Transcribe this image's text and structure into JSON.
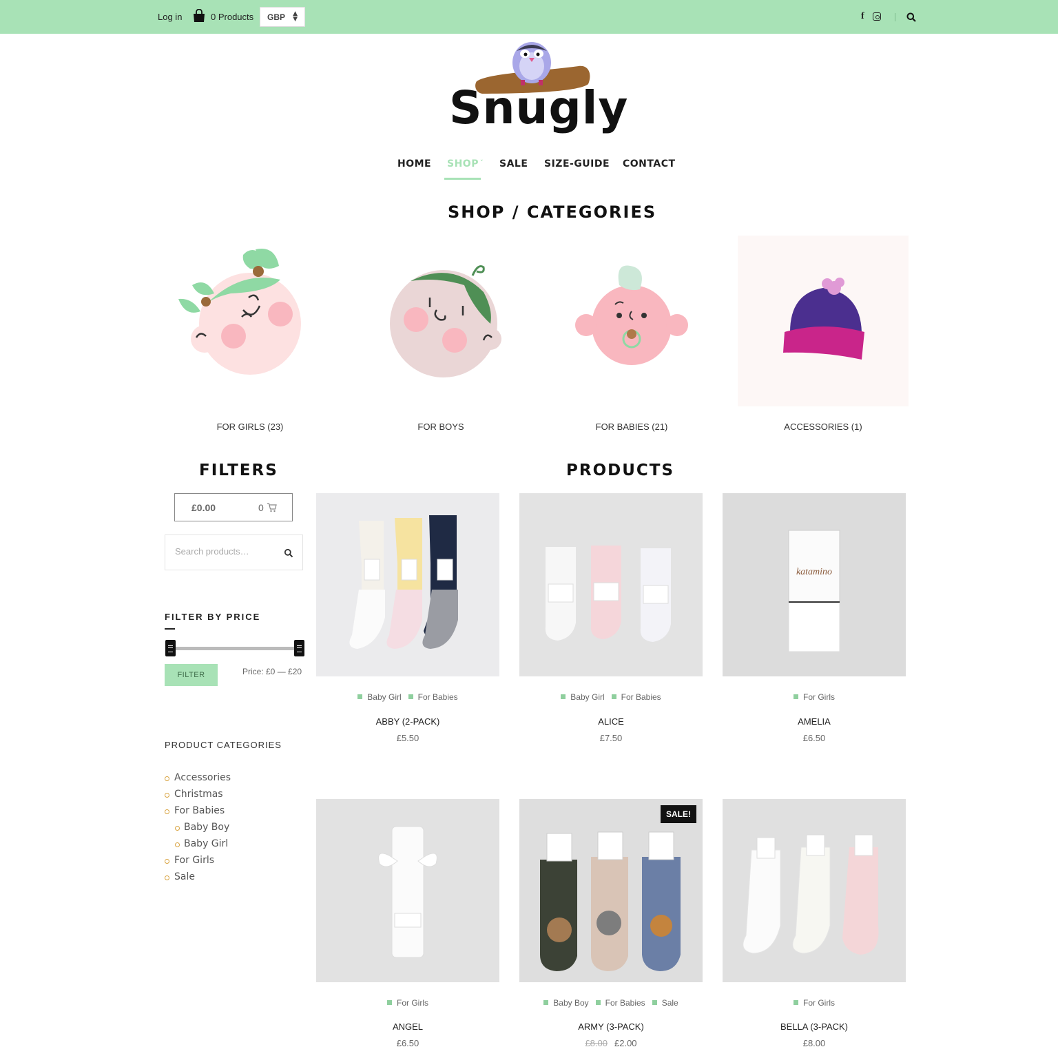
{
  "topbar": {
    "login_label": "Log in",
    "products_label": "0 Products",
    "currency": "GBP",
    "icons": [
      "shopping-bag-icon",
      "facebook-icon",
      "instagram-icon",
      "search-icon"
    ]
  },
  "brand": {
    "name": "Snugly"
  },
  "nav": {
    "items": [
      "HOME",
      "SHOP",
      "SALE",
      "SIZE-GUIDE",
      "CONTACT"
    ],
    "active": "SHOP",
    "dropdown_indicator": "˅"
  },
  "colors": {
    "accent": "#a8e2b6",
    "text_dark": "#111111",
    "bullet": "#d9a441",
    "tag_square": "#8fcf9e"
  },
  "headings": {
    "categories": "SHOP / CATEGORIES",
    "filters": "FILTERS",
    "products": "PRODUCTS"
  },
  "categories": [
    {
      "label": "FOR GIRLS (23)",
      "icon": "girl-face-icon"
    },
    {
      "label": "FOR BOYS",
      "icon": "boy-face-icon"
    },
    {
      "label": "FOR BABIES (21)",
      "icon": "baby-face-icon"
    },
    {
      "label": "ACCESSORIES (1)",
      "icon": "beanie-hat-icon"
    }
  ],
  "filters": {
    "cart_total": "£0.00",
    "cart_count": "0",
    "search_placeholder": "Search products…",
    "filter_by_price": "FILTER BY PRICE",
    "filter_button": "FILTER",
    "price_range": "Price: £0 — £20",
    "product_categories_title": "PRODUCT CATEGORIES",
    "product_categories": [
      {
        "label": "Accessories",
        "level": 0
      },
      {
        "label": "Christmas",
        "level": 0
      },
      {
        "label": "For Babies",
        "level": 0
      },
      {
        "label": "Baby Boy",
        "level": 1
      },
      {
        "label": "Baby Girl",
        "level": 1
      },
      {
        "label": "For Girls",
        "level": 0
      },
      {
        "label": "Sale",
        "level": 0
      }
    ]
  },
  "products": [
    {
      "name": "ABBY (2-PACK)",
      "price": "£5.50",
      "tags": [
        "Baby Girl",
        "For Babies"
      ]
    },
    {
      "name": "ALICE",
      "price": "£7.50",
      "tags": [
        "Baby Girl",
        "For Babies"
      ]
    },
    {
      "name": "AMELIA",
      "price": "£6.50",
      "tags": [
        "For Girls"
      ]
    },
    {
      "name": "ANGEL",
      "price": "£6.50",
      "tags": [
        "For Girls"
      ]
    },
    {
      "name": "ARMY (3-PACK)",
      "old_price": "£8.00",
      "price": "£2.00",
      "tags": [
        "Baby Boy",
        "For Babies",
        "Sale"
      ],
      "badge": "SALE!"
    },
    {
      "name": "BELLA (3-PACK)",
      "price": "£8.00",
      "tags": [
        "For Girls"
      ]
    }
  ]
}
